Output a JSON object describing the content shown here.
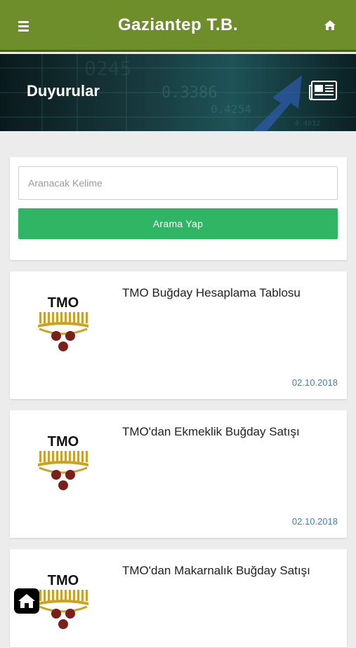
{
  "header": {
    "title": "Gaziantep T.B.",
    "menu_icon": "hamburger-menu-icon",
    "home_icon": "home-icon",
    "bg_color": "#6e8d2b"
  },
  "hero": {
    "title": "Duyurular",
    "icon": "newspaper-icon"
  },
  "search": {
    "placeholder": "Aranacak Kelime",
    "value": "",
    "button_label": "Arama Yap",
    "button_color": "#2fb564"
  },
  "announcements": [
    {
      "logo_text": "TMO",
      "title": "TMO Buğday Hesaplama Tablosu",
      "date": "02.10.2018"
    },
    {
      "logo_text": "TMO",
      "title": "TMO'dan Ekmeklik Buğday Satışı",
      "date": "02.10.2018"
    },
    {
      "logo_text": "TMO",
      "title": "TMO'dan Makarnalık Buğday Satışı",
      "date": ""
    }
  ],
  "floating": {
    "icon": "home-icon"
  }
}
